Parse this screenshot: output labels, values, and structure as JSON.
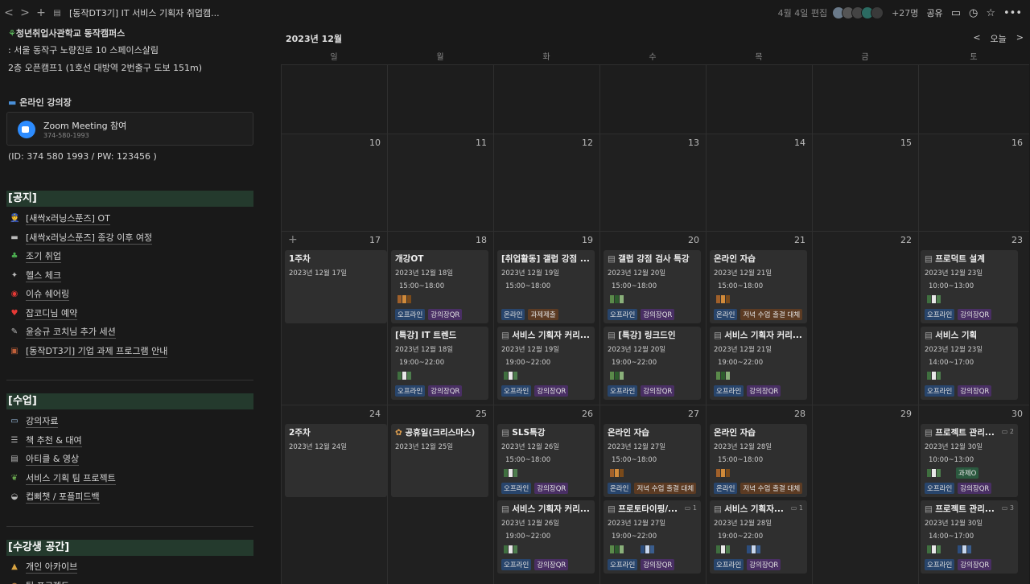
{
  "topbar": {
    "back": "<",
    "forward": ">",
    "add": "+",
    "title": "[동작DT3기] IT 서비스 기획자 취업캠...",
    "edited": "4월 4일 편집",
    "count": "+27명",
    "share": "공유",
    "icons": [
      "chevron-left-icon",
      "chevron-right-icon",
      "plus-icon",
      "page-icon",
      "comment-icon",
      "clock-icon",
      "star-icon",
      "more-icon"
    ]
  },
  "left": {
    "org": "청년취업사관학교 동작캠퍼스",
    "addr": ": 서울 동작구 노량진로 10 스페이스살림",
    "floor": "2층 오픈캠프1 (1호선 대방역 2번출구 도보 151m)",
    "online": "온라인 강의장",
    "zoom_title": "Zoom Meeting 참여",
    "zoom_sub": "374-580-1993",
    "zoom_id": "(ID: 374 580 1993 / PW: 123456 )",
    "notice_title": "[공지]",
    "notice": [
      {
        "icon": "police-icon",
        "label": "[새싹x러닝스푼즈] OT"
      },
      {
        "icon": "railway-icon",
        "label": "[새싹x러닝스푼즈] 종강 이후 여정"
      },
      {
        "icon": "clover-icon",
        "label": "조기 취업"
      },
      {
        "icon": "sparkle-icon",
        "label": "헬스 체크"
      },
      {
        "icon": "siren-icon",
        "label": "이슈 쉐어링"
      },
      {
        "icon": "heart-icon",
        "label": "잡코디님 예약"
      },
      {
        "icon": "memo-icon",
        "label": "윤승규 코치님 추가 세션"
      },
      {
        "icon": "briefcase-icon",
        "label": "[동작DT3기] 기업 과제 프로그램 안내"
      }
    ],
    "class_title": "[수업]",
    "classes": [
      {
        "icon": "book-icon",
        "label": "강의자료"
      },
      {
        "icon": "books-icon",
        "label": "책 추천 & 대여"
      },
      {
        "icon": "document-icon",
        "label": "아티클 & 영상"
      },
      {
        "icon": "dragon-icon",
        "label": "서비스 기획 팀 프로젝트"
      },
      {
        "icon": "bowl-icon",
        "label": "컵삐챗 / 포플피드백"
      }
    ],
    "student_title": "[수강생 공간]",
    "students": [
      {
        "icon": "lock-icon",
        "label": "개인 아카이브"
      },
      {
        "icon": "bear-icon",
        "label": "팀 프로젝트"
      }
    ]
  },
  "calendar": {
    "month": "2023년 12월",
    "today": "오늘",
    "prev": "<",
    "next": ">",
    "days": [
      "일",
      "월",
      "화",
      "수",
      "목",
      "금",
      "토"
    ],
    "row1": [
      "10",
      "11",
      "12",
      "13",
      "14",
      "15",
      "16"
    ],
    "row2": [
      "17",
      "18",
      "19",
      "20",
      "21",
      "22",
      "23"
    ],
    "row3": [
      "24",
      "25",
      "26",
      "27",
      "28",
      "29",
      "30"
    ],
    "tags": {
      "offline": "오프라인",
      "qr": "강의장QR",
      "online": "온라인",
      "hw": "과제제출",
      "dinner": "저녁 수업 출결 대체",
      "done": "과제O"
    },
    "events": {
      "w3": {
        "title": "1주차",
        "date": "2023년 12월 17일"
      },
      "m18a": {
        "title": "개강OT",
        "date": "2023년 12월 18일",
        "time": "15:00~18:00"
      },
      "m18b": {
        "title": "[특강] IT 트렌드",
        "date": "2023년 12월 18일",
        "time": "19:00~22:00"
      },
      "t19a": {
        "title": "[취업활동] 갤럽 강점 ...",
        "date": "2023년 12월 19일",
        "time": "15:00~18:00"
      },
      "t19b": {
        "title": "서비스 기획자 커리...",
        "date": "2023년 12월 19일",
        "time": "19:00~22:00"
      },
      "w20a": {
        "title": "갤럽 강점 검사 특강",
        "date": "2023년 12월 20일",
        "time": "15:00~18:00"
      },
      "w20b": {
        "title": "[특강] 링크드인",
        "date": "2023년 12월 20일",
        "time": "19:00~22:00"
      },
      "th21a": {
        "title": "온라인 자습",
        "date": "2023년 12월 21일",
        "time": "15:00~18:00"
      },
      "th21b": {
        "title": "서비스 기획자 커리...",
        "date": "2023년 12월 21일",
        "time": "19:00~22:00"
      },
      "s23a": {
        "title": "프로덕트 설계",
        "date": "2023년 12월 23일",
        "time": "10:00~13:00"
      },
      "s23b": {
        "title": "서비스 기획",
        "date": "2023년 12월 23일",
        "time": "14:00~17:00"
      },
      "w24": {
        "title": "2주차",
        "date": "2023년 12월 24일"
      },
      "m25": {
        "title": "공휴일(크리스마스)",
        "date": "2023년 12월 25일"
      },
      "t26a": {
        "title": "SLS특강",
        "date": "2023년 12월 26일",
        "time": "15:00~18:00"
      },
      "t26b": {
        "title": "서비스 기획자 커리...",
        "date": "2023년 12월 26일",
        "time": "19:00~22:00"
      },
      "w27a": {
        "title": "온라인 자습",
        "date": "2023년 12월 27일",
        "time": "15:00~18:00"
      },
      "w27b": {
        "title": "프로토타이핑/...",
        "date": "2023년 12월 27일",
        "time": "19:00~22:00",
        "comments": "1"
      },
      "th28a": {
        "title": "온라인 자습",
        "date": "2023년 12월 28일",
        "time": "15:00~18:00"
      },
      "th28b": {
        "title": "서비스 기획자...",
        "date": "2023년 12월 28일",
        "time": "19:00~22:00",
        "comments": "1"
      },
      "s30a": {
        "title": "프로젝트 관리...",
        "date": "2023년 12월 30일",
        "time": "10:00~13:00",
        "comments": "2"
      },
      "s30b": {
        "title": "프로젝트 관리...",
        "date": "2023년 12월 30일",
        "time": "14:00~17:00",
        "comments": "3"
      }
    }
  }
}
